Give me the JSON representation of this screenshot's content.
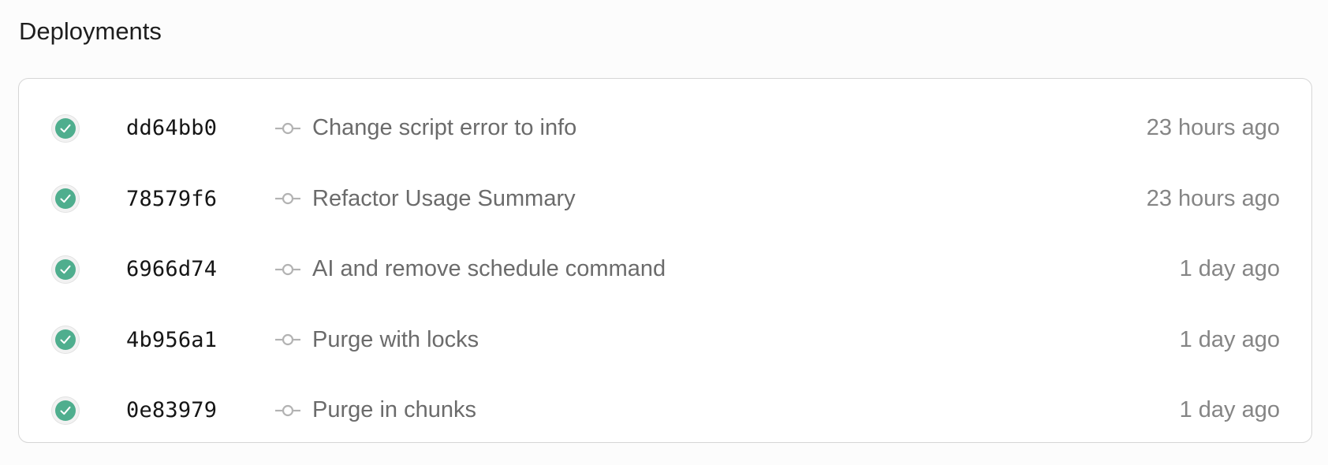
{
  "section": {
    "title": "Deployments"
  },
  "colors": {
    "success": "#4fae8e",
    "hash_text": "#151515",
    "message_text": "#6b6b6b",
    "time_text": "#858585",
    "border": "#d6d6d6"
  },
  "deployments": [
    {
      "status": "success",
      "status_icon": "check-circle-icon",
      "commit_icon": "git-commit-icon",
      "hash": "dd64bb0",
      "message": "Change script error to info",
      "time": "23 hours ago"
    },
    {
      "status": "success",
      "status_icon": "check-circle-icon",
      "commit_icon": "git-commit-icon",
      "hash": "78579f6",
      "message": "Refactor Usage Summary",
      "time": "23 hours ago"
    },
    {
      "status": "success",
      "status_icon": "check-circle-icon",
      "commit_icon": "git-commit-icon",
      "hash": "6966d74",
      "message": "AI and remove schedule command",
      "time": "1 day ago"
    },
    {
      "status": "success",
      "status_icon": "check-circle-icon",
      "commit_icon": "git-commit-icon",
      "hash": "4b956a1",
      "message": "Purge with locks",
      "time": "1 day ago"
    },
    {
      "status": "success",
      "status_icon": "check-circle-icon",
      "commit_icon": "git-commit-icon",
      "hash": "0e83979",
      "message": "Purge in chunks",
      "time": "1 day ago"
    }
  ]
}
